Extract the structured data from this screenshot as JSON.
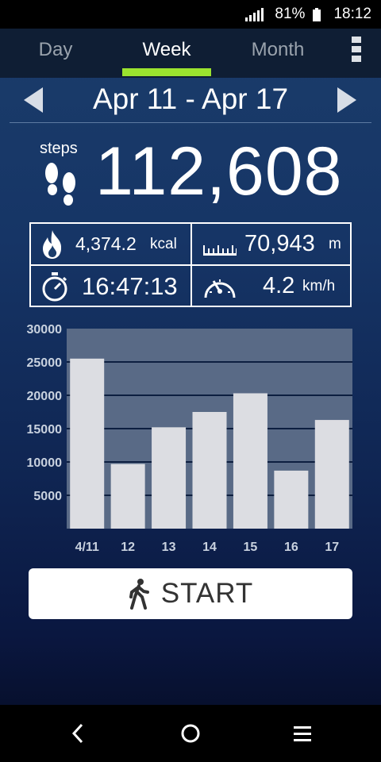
{
  "status_bar": {
    "battery": "81%",
    "time": "18:12"
  },
  "tabs": [
    {
      "label": "Day"
    },
    {
      "label": "Week",
      "active": true
    },
    {
      "label": "Month"
    }
  ],
  "week_nav": {
    "range": "Apr 11 - Apr 17"
  },
  "steps": {
    "label": "steps",
    "value": "112,608"
  },
  "stats": {
    "calories": {
      "value": "4,374.2",
      "unit": "kcal"
    },
    "distance": {
      "value": "70,943",
      "unit": "m"
    },
    "duration": {
      "value": "16:47:13"
    },
    "speed": {
      "value": "4.2",
      "unit": "km/h"
    }
  },
  "chart_data": {
    "type": "bar",
    "categories": [
      "4/11",
      "12",
      "13",
      "14",
      "15",
      "16",
      "17"
    ],
    "values": [
      25500,
      9700,
      15200,
      17500,
      20300,
      8700,
      16300
    ],
    "yticks": [
      "30000",
      "25000",
      "20000",
      "15000",
      "10000",
      "5000"
    ],
    "ylim": [
      0,
      30000
    ],
    "grid": true
  },
  "start_button": {
    "label": "START"
  },
  "colors": {
    "accent": "#9be32f",
    "bar": "#dcdde2",
    "plot_bg": "#596a86"
  },
  "icons": [
    "signal-icon",
    "battery-icon",
    "more-vert-icon",
    "prev-week-icon",
    "next-week-icon",
    "footsteps-icon",
    "flame-icon",
    "ruler-icon",
    "stopwatch-icon",
    "speedometer-icon",
    "walking-icon",
    "back-icon",
    "home-icon",
    "recents-icon"
  ]
}
